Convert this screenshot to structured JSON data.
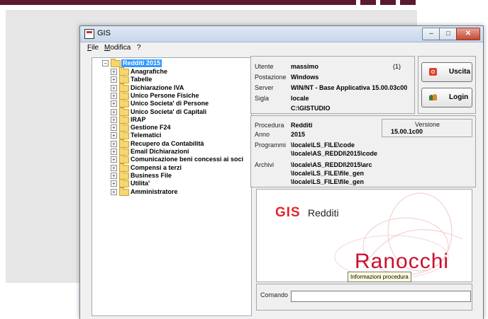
{
  "window": {
    "title": "GIS"
  },
  "menubar": [
    {
      "label": "File",
      "accel": "F",
      "rest": "ile"
    },
    {
      "label": "Modifica",
      "accel": "M",
      "rest": "odifica"
    },
    {
      "label": "?",
      "accel": "",
      "rest": "?"
    }
  ],
  "tree": {
    "root": "Redditi 2015",
    "items": [
      "Anagrafiche",
      "Tabelle",
      "Dichiarazione IVA",
      "Unico Persone Fisiche",
      "Unico Societa' di Persone",
      "Unico Societa' di Capitali",
      "IRAP",
      "Gestione F24",
      "Telematici",
      "Recupero da Contabilità",
      "Email Dichiarazioni",
      "Comunicazione beni concessi ai soci",
      "Compensi a terzi",
      "Business File",
      "Utilita'",
      "Amministratore"
    ]
  },
  "user_panel": {
    "utente_label": "Utente",
    "utente": "massimo",
    "utente_id": "(1)",
    "postazione_label": "Postazione",
    "postazione": "Windows",
    "server_label": "Server",
    "server": "WIN/NT - Base Applicativa 15.00.03c00",
    "sigla_label": "Sigla",
    "sigla": "locale",
    "path": "C:\\GISTUDIO"
  },
  "buttons": {
    "exit": "Uscita",
    "login": "Login"
  },
  "procedure_panel": {
    "procedura_label": "Procedura",
    "procedura": "Redditi",
    "anno_label": "Anno",
    "anno": "2015",
    "versione_label": "Versione",
    "versione": "15.00.1c00",
    "programmi_label": "Programmi",
    "programmi": [
      "\\locale\\LS_FILE\\code",
      "\\locale\\AS_REDDI\\2015\\code"
    ],
    "archivi_label": "Archivi",
    "archivi": [
      "\\locale\\AS_REDDI\\2015\\arc",
      "\\locale\\LS_FILE\\file_gen",
      "\\locale\\LS_FILE\\file_gen"
    ]
  },
  "logo": {
    "gis": "GIS",
    "product": "Redditi",
    "brand": "Ranocchi"
  },
  "tooltip": "Informazioni procedura",
  "command": {
    "label": "Comando",
    "value": ""
  }
}
